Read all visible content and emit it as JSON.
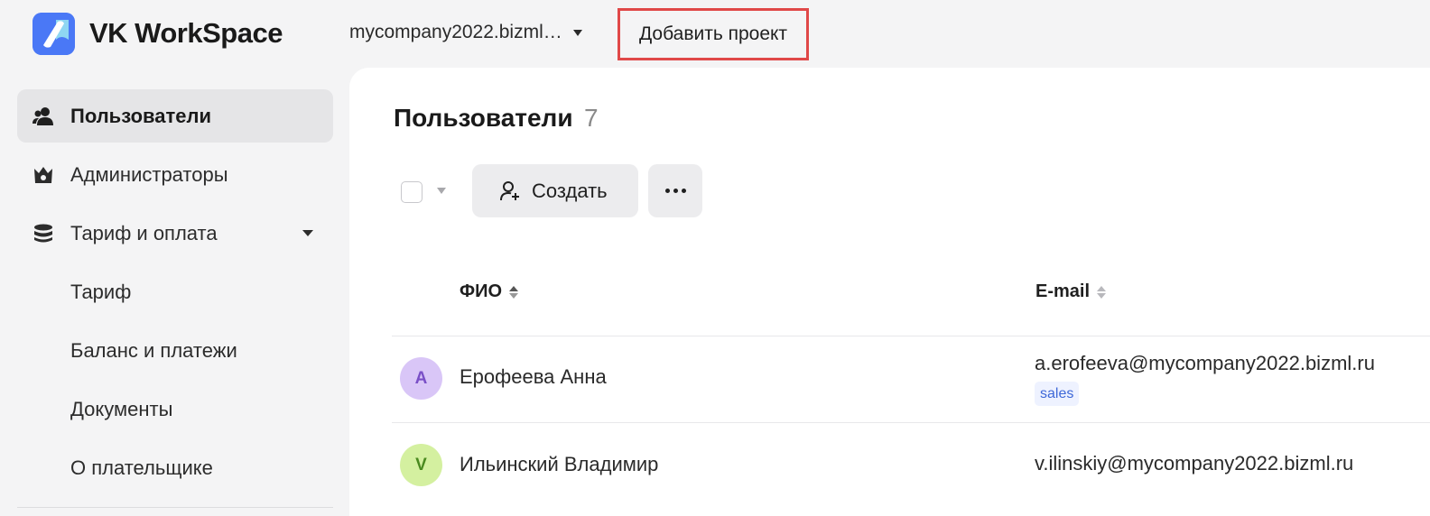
{
  "header": {
    "app_name": "VK WorkSpace",
    "company": "mycompany2022.bizml…",
    "add_project_label": "Добавить проект"
  },
  "sidebar": {
    "items": [
      {
        "label": "Пользователи",
        "icon": "users-icon",
        "active": true
      },
      {
        "label": "Администраторы",
        "icon": "crown-icon",
        "active": false
      },
      {
        "label": "Тариф и оплата",
        "icon": "database-icon",
        "active": false,
        "expandable": true
      },
      {
        "label": "Тариф",
        "sub": true
      },
      {
        "label": "Баланс и платежи",
        "sub": true
      },
      {
        "label": "Документы",
        "sub": true
      },
      {
        "label": "О плательщике",
        "sub": true
      }
    ]
  },
  "main": {
    "title": "Пользователи",
    "count": "7",
    "create_label": "Создать",
    "columns": {
      "name": "ФИО",
      "email": "E-mail"
    },
    "rows": [
      {
        "initial": "А",
        "name": "Ерофеева Анна",
        "email": "a.erofeeva@mycompany2022.bizml.ru",
        "tag": "sales",
        "avatar_bg": "#d9c6f7",
        "avatar_fg": "#7a4fc7"
      },
      {
        "initial": "V",
        "name": "Ильинский Владимир",
        "email": "v.ilinskiy@mycompany2022.bizml.ru",
        "tag": "",
        "avatar_bg": "#d4f0a0",
        "avatar_fg": "#4a8a1f"
      }
    ]
  },
  "colors": {
    "highlight_border": "#e04848",
    "brand_blue": "#4e7cff",
    "tag_text": "#3e68d8"
  }
}
